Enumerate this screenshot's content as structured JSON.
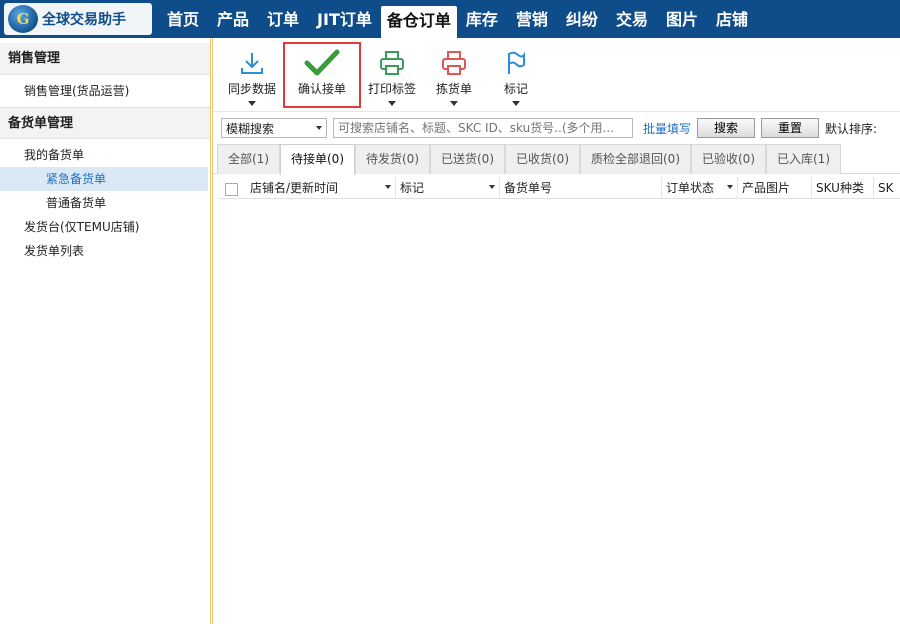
{
  "app": {
    "logo_mark": "G",
    "title": "全球交易助手"
  },
  "nav": {
    "items": [
      "首页",
      "产品",
      "订单",
      "JIT订单",
      "备仓订单",
      "库存",
      "营销",
      "纠纷",
      "交易",
      "图片",
      "店铺"
    ],
    "active_index": 4
  },
  "sidebar": {
    "section1": "销售管理",
    "item_sales": "销售管理(货品运营)",
    "section2": "备货单管理",
    "my_orders": "我的备货单",
    "urgent": "紧急备货单",
    "normal": "普通备货单",
    "shipping_desk": "发货台(仅TEMU店铺)",
    "ship_list": "发货单列表"
  },
  "toolbar": {
    "sync": "同步数据",
    "confirm": "确认接单",
    "print": "打印标签",
    "pick": "拣货单",
    "mark": "标记"
  },
  "search": {
    "mode": "模糊搜索",
    "placeholder": "可搜索店铺名、标题、SKC ID、sku货号..(多个用...",
    "batch": "批量填写",
    "search_btn": "搜索",
    "reset_btn": "重置",
    "sort_label": "默认排序:"
  },
  "tabs": [
    "全部(1)",
    "待接单(0)",
    "待发货(0)",
    "已送货(0)",
    "已收货(0)",
    "质检全部退回(0)",
    "已验收(0)",
    "已入库(1)"
  ],
  "active_tab": 1,
  "table": {
    "headers": [
      "店铺名/更新时间",
      "标记",
      "备货单号",
      "订单状态",
      "产品图片",
      "SKU种类",
      "SK"
    ]
  },
  "colors": {
    "nav_bg": "#0e4d8a",
    "accent": "#1d6ec7",
    "highlight": "#e53935"
  }
}
